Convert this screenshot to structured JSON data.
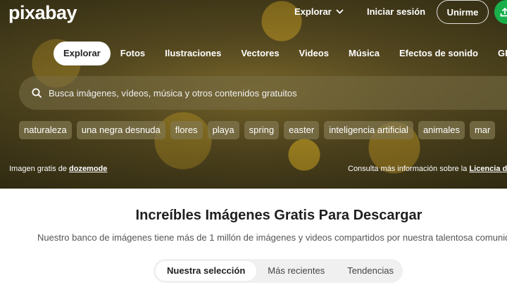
{
  "header": {
    "logo": "pixabay",
    "explore_label": "Explorar",
    "login_label": "Iniciar sesión",
    "join_label": "Unirme"
  },
  "nav": {
    "tabs": [
      {
        "label": "Explorar",
        "active": true
      },
      {
        "label": "Fotos"
      },
      {
        "label": "Ilustraciones"
      },
      {
        "label": "Vectores"
      },
      {
        "label": "Videos"
      },
      {
        "label": "Música"
      },
      {
        "label": "Efectos de sonido"
      },
      {
        "label": "GIF"
      }
    ]
  },
  "search": {
    "placeholder": "Busca imágenes, vídeos, música y otros contenidos gratuitos"
  },
  "chips": [
    "naturaleza",
    "una negra desnuda",
    "flores",
    "playa",
    "spring",
    "easter",
    "inteligencia artificial",
    "animales",
    "mar"
  ],
  "credits": {
    "left_prefix": "Imagen gratis de ",
    "left_author": "dozemode",
    "right_prefix": "Consulta más información sobre la ",
    "right_link": "Licencia de"
  },
  "main": {
    "title": "Increíbles Imágenes Gratis Para Descargar",
    "subtitle": "Nuestro banco de imágenes tiene más de 1 millón de imágenes y videos compartidos por nuestra talentosa comunid",
    "tabs": [
      {
        "label": "Nuestra selección",
        "active": true
      },
      {
        "label": "Más recientes"
      },
      {
        "label": "Tendencias"
      }
    ]
  },
  "colors": {
    "upload_button": "#19b04b"
  }
}
